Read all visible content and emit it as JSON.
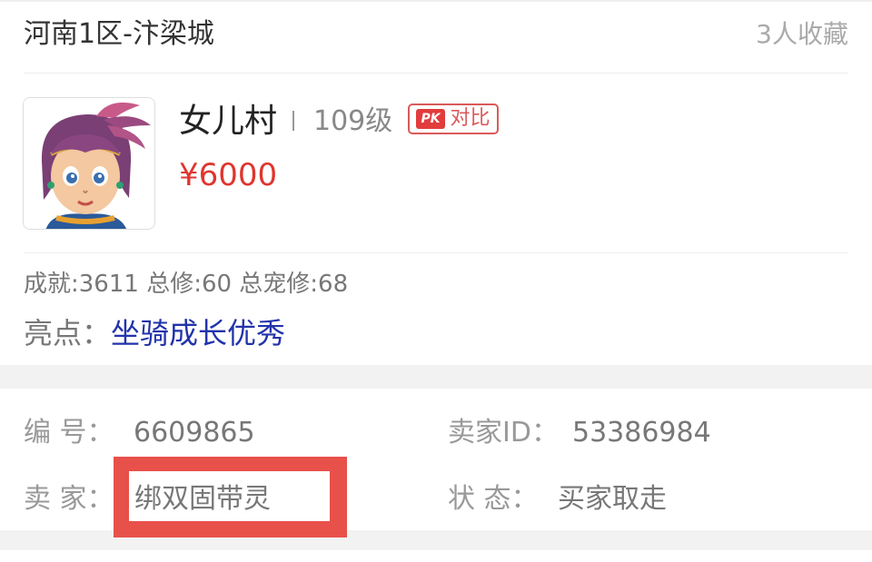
{
  "listing": {
    "server": "河南1区-汴梁城",
    "favorites": "3人收藏",
    "role_name": "女儿村",
    "level": "109级",
    "pk_logo": "PK",
    "pk_label": "对比",
    "price": "¥6000",
    "stats": "成就:3611 总修:60 总宠修:68",
    "highlight_label": "亮点：",
    "highlight_value": "坐骑成长优秀"
  },
  "details": {
    "id_label": "编  号：",
    "id_value": "6609865",
    "seller_id_label": "卖家ID：",
    "seller_id_value": "53386984",
    "seller_label": "卖  家：",
    "seller_value": "绑双固带灵",
    "status_label": "状  态：",
    "status_value": "买家取走"
  },
  "colors": {
    "price": "#e0352f",
    "highlight": "#2233aa",
    "annotation_box": "#e8504a"
  }
}
